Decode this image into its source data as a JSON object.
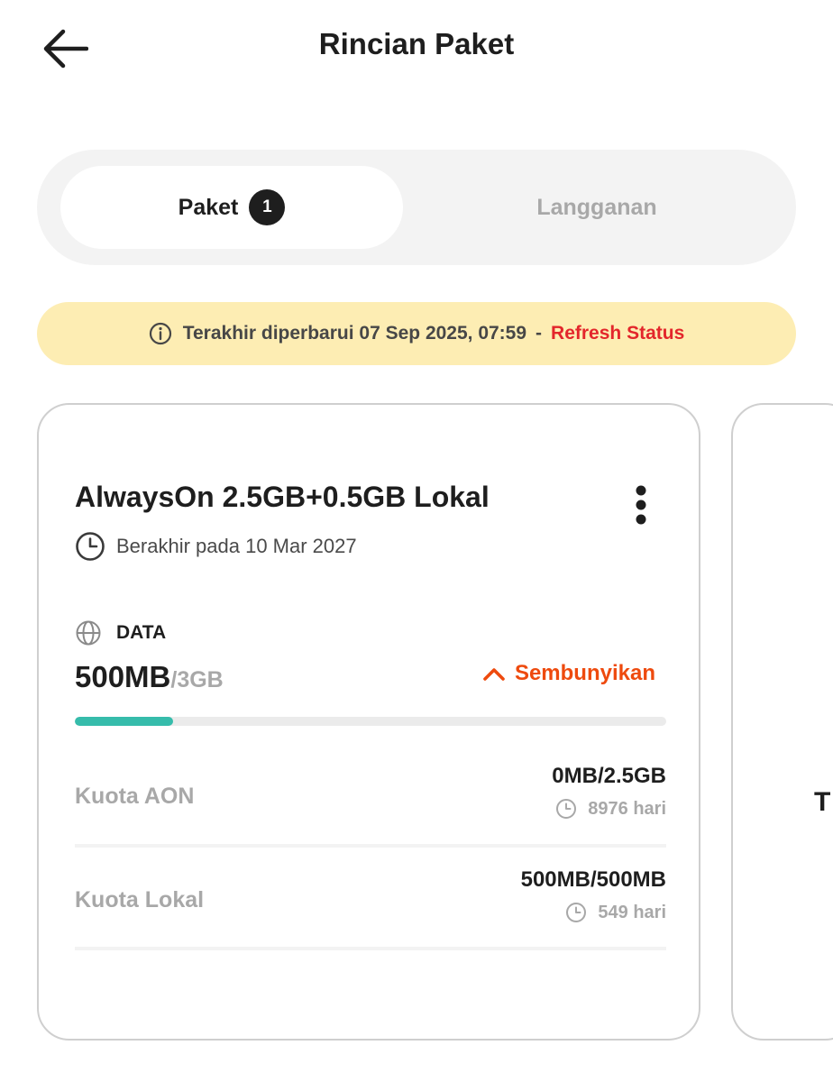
{
  "header": {
    "title": "Rincian Paket",
    "back_icon": "arrow-left-icon"
  },
  "tabs": [
    {
      "label": "Paket",
      "badge": "1",
      "active": true
    },
    {
      "label": "Langganan",
      "active": false
    }
  ],
  "notice": {
    "icon": "info-icon",
    "text": "Terakhir diperbarui 07 Sep 2025, 07:59",
    "separator": "-",
    "action": "Refresh Status"
  },
  "package": {
    "name": "AlwaysOn 2.5GB+0.5GB Lokal",
    "expiry": "Berakhir pada 10 Mar 2027",
    "data_label": "DATA",
    "used": "500MB",
    "total": "/3GB",
    "usage_fraction": 0.1667,
    "hide_label": "Sembunyikan",
    "quotas": [
      {
        "label": "Kuota AON",
        "value": "0MB/2.5GB",
        "days": "8976 hari"
      },
      {
        "label": "Kuota Lokal",
        "value": "500MB/500MB",
        "days": "549 hari"
      }
    ]
  },
  "next_card": {
    "peek_text": "T"
  },
  "colors": {
    "accent": "#ee4a0e",
    "refresh": "#e3262b",
    "progress": "#36bcab",
    "notice_bg": "#fdedb3",
    "muted": "#a8a8a8"
  }
}
